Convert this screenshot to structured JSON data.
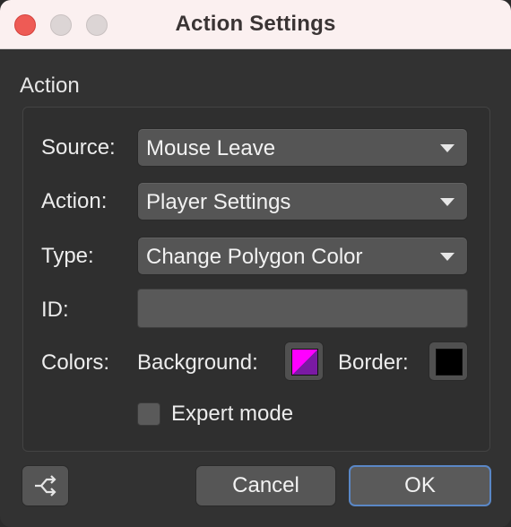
{
  "window": {
    "title": "Action Settings"
  },
  "section": {
    "label": "Action"
  },
  "form": {
    "source": {
      "label": "Source:",
      "value": "Mouse Leave"
    },
    "action": {
      "label": "Action:",
      "value": "Player Settings"
    },
    "type": {
      "label": "Type:",
      "value": "Change Polygon Color"
    },
    "id": {
      "label": "ID:",
      "value": ""
    },
    "colors": {
      "label": "Colors:",
      "background_label": "Background:",
      "border_label": "Border:",
      "background_colors": [
        "#ff00ff",
        "#7a1aa3"
      ],
      "border_color": "#000000"
    },
    "expert_mode": {
      "label": "Expert mode",
      "checked": false
    }
  },
  "footer": {
    "share_icon": "share-icon",
    "cancel_label": "Cancel",
    "ok_label": "OK"
  }
}
